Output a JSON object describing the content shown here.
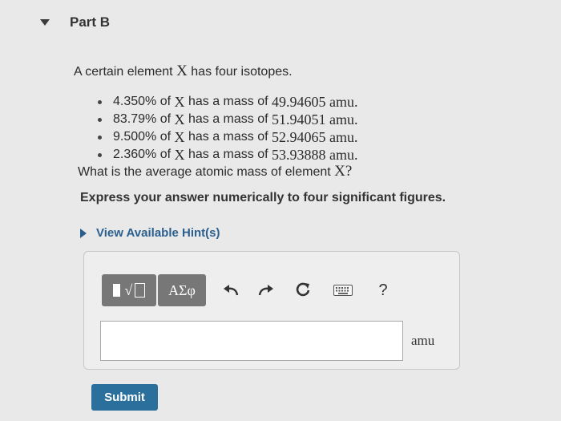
{
  "part": {
    "title": "Part B"
  },
  "problem": {
    "intro_prefix": "A certain element",
    "symbol": "X",
    "intro_suffix": "has four isotopes.",
    "isotopes": [
      {
        "percent": "4.350% of",
        "sym": "X",
        "mid": "has a mass of",
        "mass": "49.94605 amu."
      },
      {
        "percent": "83.79% of",
        "sym": "X",
        "mid": "has a mass of",
        "mass": "51.94051 amu."
      },
      {
        "percent": "9.500% of",
        "sym": "X",
        "mid": "has a mass of",
        "mass": "52.94065 amu."
      },
      {
        "percent": "2.360% of",
        "sym": "X",
        "mid": "has a mass of",
        "mass": "53.93888 amu."
      }
    ],
    "question_prefix": "What is the average atomic mass of element",
    "question_sym": "X?",
    "instruction": "Express your answer numerically to four significant figures."
  },
  "hint": {
    "label": "View Available Hint(s)"
  },
  "toolbar": {
    "greek_label": "ΑΣφ",
    "help_label": "?"
  },
  "answer": {
    "value": "",
    "unit": "amu"
  },
  "submit": {
    "label": "Submit"
  }
}
